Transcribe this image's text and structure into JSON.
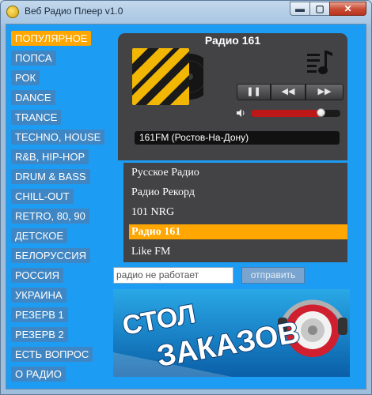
{
  "window": {
    "title": "Веб Радио Плеер v1.0",
    "minimize_glyph": "▬",
    "maximize_glyph": "▢",
    "close_glyph": "✕"
  },
  "genres": [
    {
      "label": "ПОПУЛЯРНОЕ",
      "active": true
    },
    {
      "label": "ПОПСА"
    },
    {
      "label": "РОК"
    },
    {
      "label": "DANCE"
    },
    {
      "label": "TRANCE"
    },
    {
      "label": "TECHNO, HOUSE"
    },
    {
      "label": "R&B, HIP-HOP"
    },
    {
      "label": "DRUM & BASS"
    },
    {
      "label": "CHILL-OUT"
    },
    {
      "label": "RETRO, 80, 90"
    },
    {
      "label": "ДЕТСКОЕ"
    },
    {
      "label": "БЕЛОРУССИЯ"
    },
    {
      "label": "РОССИЯ"
    },
    {
      "label": "УКРАИНА"
    },
    {
      "label": "РЕЗЕРВ 1"
    },
    {
      "label": "РЕЗЕРВ 2"
    },
    {
      "label": "ЕСТЬ ВОПРОС"
    },
    {
      "label": "О РАДИО"
    }
  ],
  "player": {
    "station_title": "Радио 161",
    "now_playing": "161FM (Ростов-На-Дону)",
    "volume": 0.78,
    "icons": {
      "pause": "pause-icon",
      "rewind": "rewind-icon",
      "forward": "forward-icon",
      "volume": "speaker-icon",
      "playlist": "playlist-icon"
    },
    "pause_glyph": "❚❚",
    "rewind_glyph": "◀◀",
    "forward_glyph": "▶▶"
  },
  "stations": [
    {
      "label": "Русское Радио"
    },
    {
      "label": "Радио Рекорд"
    },
    {
      "label": "101 NRG"
    },
    {
      "label": "Радио 161",
      "active": true
    },
    {
      "label": "Like FM"
    }
  ],
  "report": {
    "input_value": "радио не работает",
    "send_label": "отправить"
  },
  "banner": {
    "logo_text": "СТОЛ ЗАКАЗОВ"
  },
  "colors": {
    "client_bg": "#1c9cf3",
    "accent": "#ffa600",
    "genre_bg": "#3f86c4",
    "player_bg": "#434346",
    "volume_fill": "#bd1717"
  }
}
